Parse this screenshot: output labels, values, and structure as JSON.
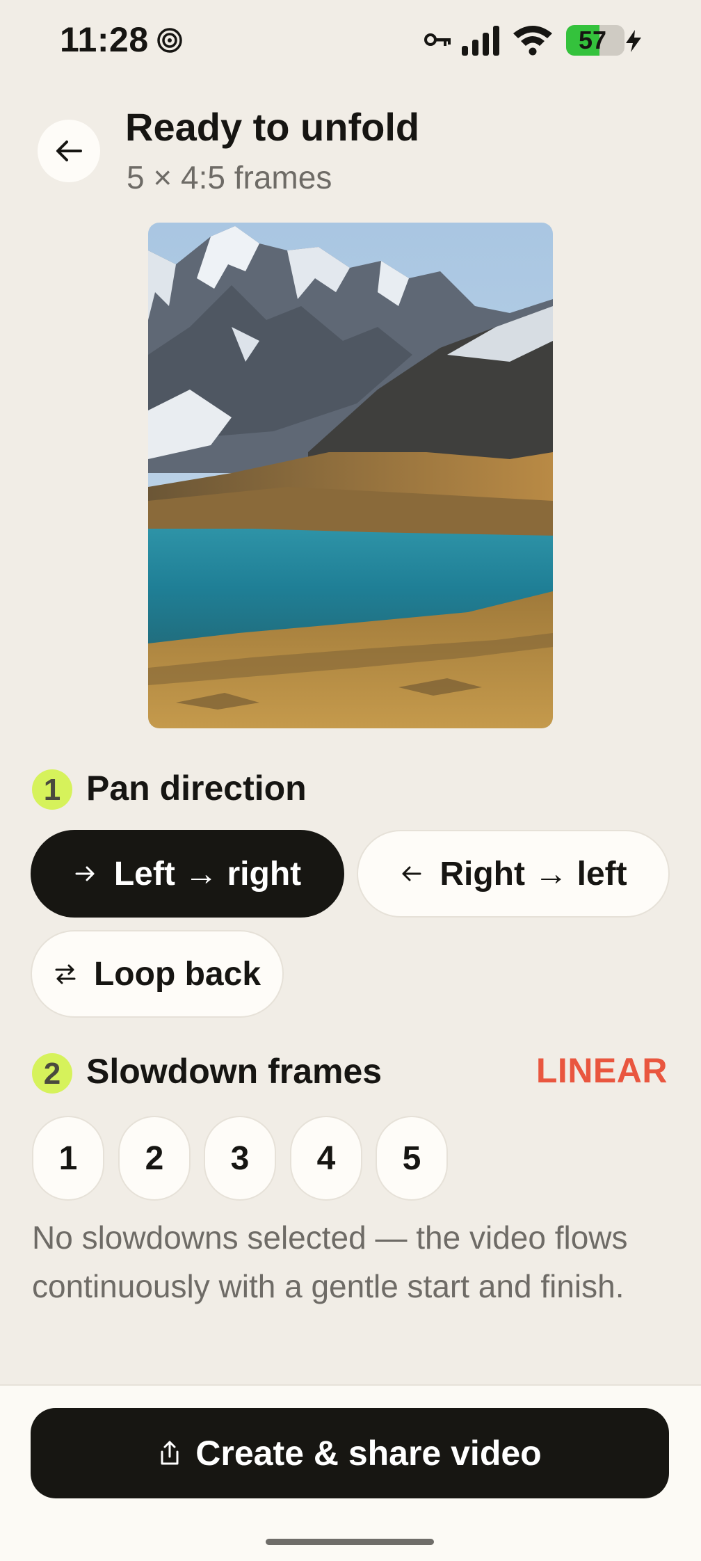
{
  "status_bar": {
    "time": "11:28",
    "battery_level": 57,
    "battery_text": "57",
    "icons": [
      "spiral-icon",
      "key-icon",
      "signal-icon",
      "wifi-icon",
      "battery-icon",
      "charging-bolt-icon"
    ]
  },
  "header": {
    "back_icon": "arrow-left-icon",
    "title": "Ready to unfold",
    "subtitle": "5 × 4:5 frames"
  },
  "preview": {
    "content": "mountain-lake-photo"
  },
  "pan_direction": {
    "step": "1",
    "title": "Pan direction",
    "options": [
      {
        "icon": "arrow-right-icon",
        "label": "Left → right",
        "selected": true
      },
      {
        "icon": "arrow-left-icon",
        "label": "Right → left",
        "selected": false
      },
      {
        "icon": "swap-arrows-icon",
        "label": "Loop back",
        "selected": false
      }
    ]
  },
  "slowdown": {
    "step": "2",
    "title": "Slowdown frames",
    "mode_label": "LINEAR",
    "frames": [
      "1",
      "2",
      "3",
      "4",
      "5"
    ],
    "hint": "No slowdowns selected — the video flows continuously with a gentle start and finish."
  },
  "cta": {
    "icon": "share-icon",
    "label": "Create & share video"
  },
  "colors": {
    "background": "#f1ede6",
    "accent_lime": "#d6f25b",
    "accent_red": "#e9563f",
    "dark": "#171612",
    "battery_green": "#34c23c"
  }
}
